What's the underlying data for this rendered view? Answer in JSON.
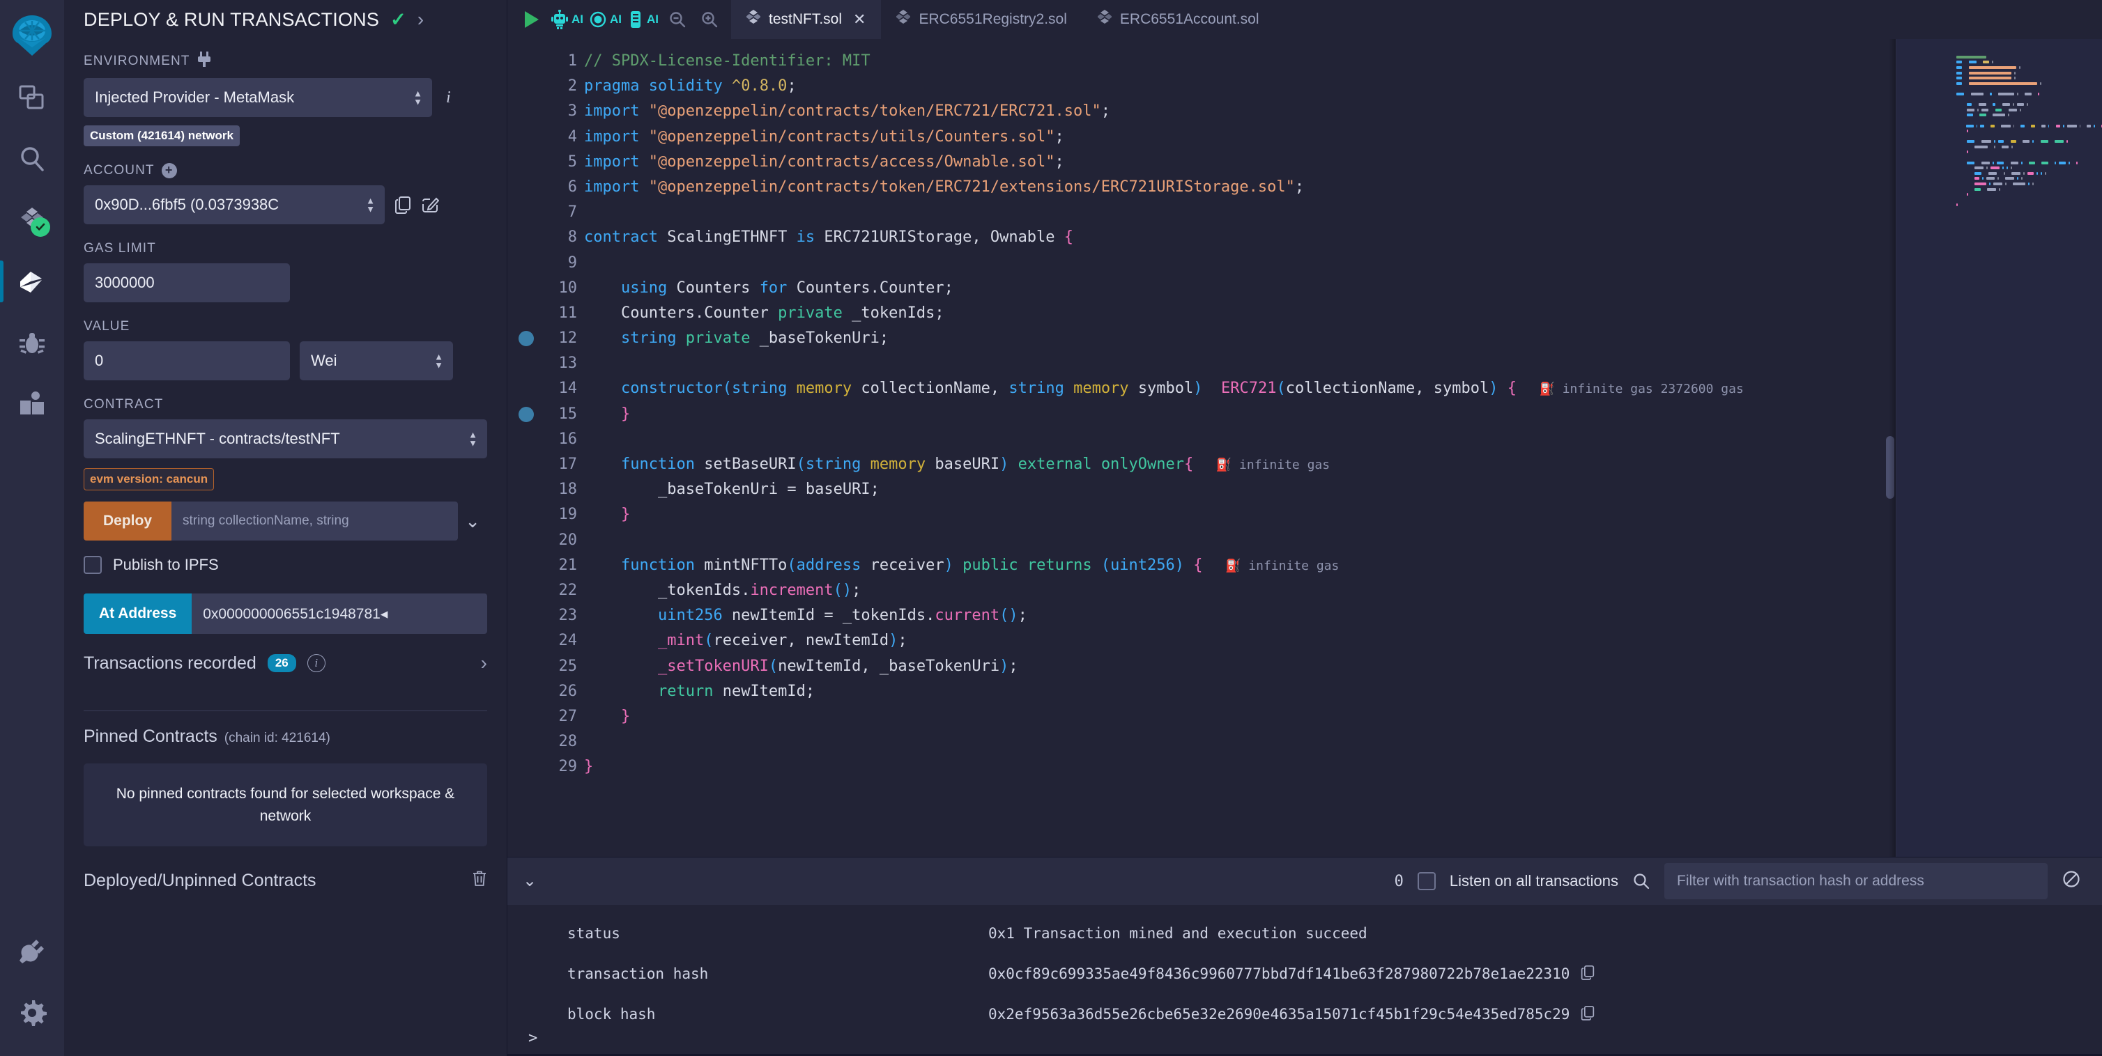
{
  "rail": {
    "items": [
      {
        "name": "remix-logo",
        "label": "Remix"
      },
      {
        "name": "file-explorer",
        "label": "File explorer"
      },
      {
        "name": "search",
        "label": "Search in files"
      },
      {
        "name": "solidity-compiler",
        "label": "Solidity compiler"
      },
      {
        "name": "deploy-run",
        "label": "Deploy & run transactions"
      },
      {
        "name": "debugger",
        "label": "Debugger"
      },
      {
        "name": "learneth",
        "label": "LearnEth"
      }
    ],
    "bottom": [
      {
        "name": "plugin-manager",
        "label": "Plugin manager"
      },
      {
        "name": "settings",
        "label": "Settings"
      }
    ]
  },
  "panel": {
    "title": "DEPLOY & RUN TRANSACTIONS",
    "environment": {
      "label": "ENVIRONMENT",
      "value": "Injected Provider - MetaMask",
      "network_badge": "Custom (421614) network"
    },
    "account": {
      "label": "ACCOUNT",
      "value": "0x90D...6fbf5 (0.0373938C"
    },
    "gas_limit": {
      "label": "GAS LIMIT",
      "value": "3000000"
    },
    "value": {
      "label": "VALUE",
      "amount": "0",
      "unit": "Wei"
    },
    "contract": {
      "label": "CONTRACT",
      "value": "ScalingETHNFT - contracts/testNFT",
      "evm_badge": "evm version: cancun"
    },
    "deploy": {
      "button": "Deploy",
      "args_placeholder": "string collectionName, string"
    },
    "publish_ipfs": "Publish to IPFS",
    "at_address": {
      "button": "At Address",
      "value": "0x000000006551c1948781◂"
    },
    "transactions_recorded": {
      "label": "Transactions recorded",
      "count": "26"
    },
    "pinned": {
      "title": "Pinned Contracts",
      "subtitle": "(chain id: 421614)",
      "empty": "No pinned contracts found for selected workspace & network"
    },
    "deployed": {
      "title": "Deployed/Unpinned Contracts"
    }
  },
  "toolbar": {
    "run_label": "run-script",
    "ai_labels": [
      "AI",
      "AI",
      "AI"
    ],
    "zoom_out": "zoom-out",
    "zoom_in": "zoom-in"
  },
  "tabs": [
    {
      "label": "testNFT.sol",
      "active": true,
      "closable": true
    },
    {
      "label": "ERC6551Registry2.sol",
      "active": false,
      "closable": false
    },
    {
      "label": "ERC6551Account.sol",
      "active": false,
      "closable": false
    }
  ],
  "editor": {
    "first_line": 1,
    "last_line": 29,
    "breakpoints": [
      12,
      15
    ],
    "gas_hints": [
      {
        "line": 14,
        "text": "infinite gas 2372600 gas"
      },
      {
        "line": 17,
        "text": "infinite gas"
      },
      {
        "line": 21,
        "text": "infinite gas"
      }
    ],
    "lines": [
      "// SPDX-License-Identifier: MIT",
      "pragma solidity ^0.8.0;",
      "import \"@openzeppelin/contracts/token/ERC721/ERC721.sol\";",
      "import \"@openzeppelin/contracts/utils/Counters.sol\";",
      "import \"@openzeppelin/contracts/access/Ownable.sol\";",
      "import \"@openzeppelin/contracts/token/ERC721/extensions/ERC721URIStorage.sol\";",
      "",
      "contract ScalingETHNFT is ERC721URIStorage, Ownable {",
      "",
      "    using Counters for Counters.Counter;",
      "    Counters.Counter private _tokenIds;",
      "    string private _baseTokenUri;",
      "",
      "    constructor(string memory collectionName, string memory symbol)  ERC721(collectionName, symbol) {",
      "    }",
      "",
      "    function setBaseURI(string memory baseURI) external onlyOwner{",
      "        _baseTokenUri = baseURI;",
      "    }",
      "",
      "    function mintNFTTo(address receiver) public returns (uint256) {",
      "        _tokenIds.increment();",
      "        uint256 newItemId = _tokenIds.current();",
      "        _mint(receiver, newItemId);",
      "        _setTokenURI(newItemId, _baseTokenUri);",
      "        return newItemId;",
      "    }",
      "",
      "}"
    ]
  },
  "terminal": {
    "count": "0",
    "listen_label": "Listen on all transactions",
    "filter_placeholder": "Filter with transaction hash or address",
    "prompt": ">",
    "log": [
      {
        "key": "status",
        "value": "0x1 Transaction mined and execution succeed",
        "copy": false
      },
      {
        "key": "transaction hash",
        "value": "0x0cf89c699335ae49f8436c9960777bbd7df141be63f287980722b78e1ae22310",
        "copy": true
      },
      {
        "key": "block hash",
        "value": "0x2ef9563a36d55e26cbe65e32e2690e4635a15071cf45b1f29c54e435ed785c29",
        "copy": true
      }
    ]
  },
  "colors": {
    "accent_blue": "#0c88b5",
    "deploy_orange": "#b5622b",
    "ok_green": "#2ecc82",
    "panel_bg": "#222336",
    "rail_bg": "#2a2c42"
  }
}
